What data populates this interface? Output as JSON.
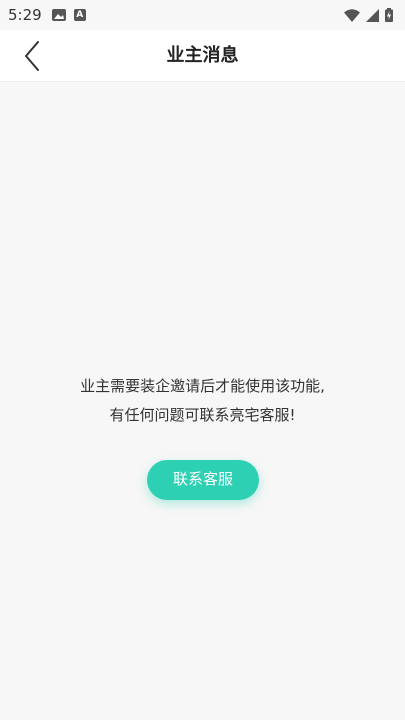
{
  "status_bar": {
    "time": "5:29",
    "a_icon_letter": "A"
  },
  "header": {
    "title": "业主消息"
  },
  "content": {
    "message_line1": "业主需要装企邀请后才能使用该功能,",
    "message_line2": "有任何问题可联系亮宅客服!",
    "contact_button": "联系客服"
  },
  "colors": {
    "accent": "#2ed0b3",
    "background": "#f7f7f7",
    "header": "#ffffff"
  }
}
